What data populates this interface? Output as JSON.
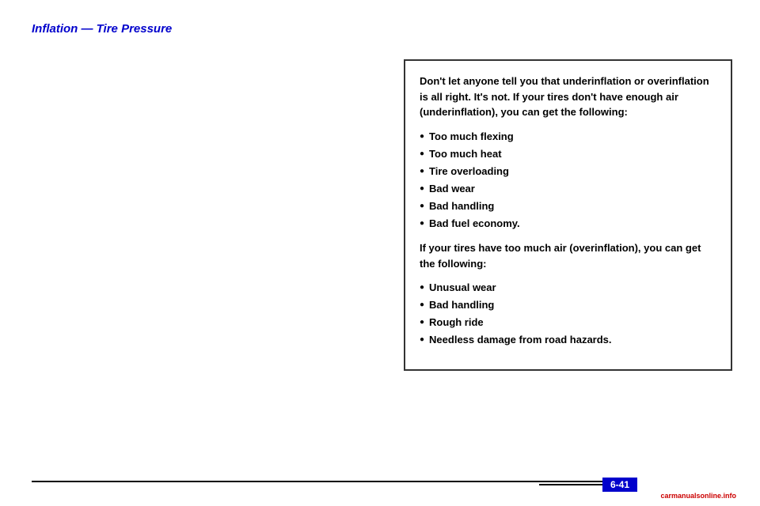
{
  "page": {
    "title": "Inflation — Tire Pressure",
    "page_number": "6-41",
    "background_color": "#ffffff"
  },
  "info_box": {
    "intro_text": "Don't let anyone tell you that underinflation or overinflation is all right. It's not. If your tires don't have enough air (underinflation), you can get the following:",
    "underinflation_items": [
      "Too much flexing",
      "Too much heat",
      "Tire overloading",
      "Bad wear",
      "Bad handling",
      "Bad fuel economy."
    ],
    "overinflation_intro": "If your tires have too much air (overinflation), you can get the following:",
    "overinflation_items": [
      "Unusual wear",
      "Bad handling",
      "Rough ride",
      "Needless damage from road hazards."
    ]
  },
  "footer": {
    "site_name": "carmanualsonline.info",
    "page_number_label": "6-41"
  }
}
